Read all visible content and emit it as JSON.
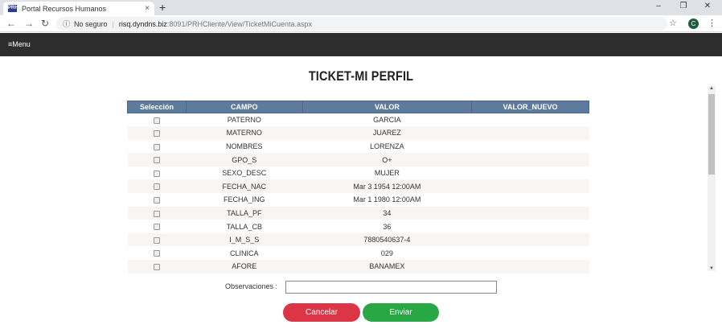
{
  "browser": {
    "tab_title": "Portal Recursos Humanos",
    "tab_favicon": "PRH",
    "tab_close": "×",
    "new_tab": "+",
    "min": "–",
    "max": "❐",
    "close": "✕",
    "back": "←",
    "forward": "→",
    "reload": "↻",
    "info_icon": "ⓘ",
    "security": "No seguro",
    "separator": "|",
    "host": "risq.dyndns.biz",
    "path": ":8091/PRHCliente/View/TicketMiCuenta.aspx",
    "star": "☆",
    "profile_initial": "C",
    "menu_dots": "⋮"
  },
  "navbar": {
    "menu_label": "≡Menu"
  },
  "page": {
    "title": "TICKET-MI PERFIL"
  },
  "grid": {
    "headers": [
      "Selección",
      "CAMPO",
      "VALOR",
      "VALOR_NUEVO"
    ],
    "rows": [
      {
        "campo": "PATERNO",
        "valor": "GARCIA",
        "nuevo": ""
      },
      {
        "campo": "MATERNO",
        "valor": "JUAREZ",
        "nuevo": ""
      },
      {
        "campo": "NOMBRES",
        "valor": "LORENZA",
        "nuevo": ""
      },
      {
        "campo": "GPO_S",
        "valor": "O+",
        "nuevo": ""
      },
      {
        "campo": "SEXO_DESC",
        "valor": "MUJER",
        "nuevo": ""
      },
      {
        "campo": "FECHA_NAC",
        "valor": "Mar 3 1954 12:00AM",
        "nuevo": ""
      },
      {
        "campo": "FECHA_ING",
        "valor": "Mar 1 1980 12:00AM",
        "nuevo": ""
      },
      {
        "campo": "TALLA_PF",
        "valor": "34",
        "nuevo": ""
      },
      {
        "campo": "TALLA_CB",
        "valor": "36",
        "nuevo": ""
      },
      {
        "campo": "I_M_S_S",
        "valor": "7880540637-4",
        "nuevo": ""
      },
      {
        "campo": "CLINICA",
        "valor": "029",
        "nuevo": ""
      },
      {
        "campo": "AFORE",
        "valor": "BANAMEX",
        "nuevo": ""
      }
    ]
  },
  "form": {
    "observaciones_label": "Observaciones :",
    "observaciones_value": ""
  },
  "buttons": {
    "cancel": "Cancelar",
    "send": "Enviar"
  },
  "colors": {
    "header": "#5d7b9d",
    "cancel": "#dc3545",
    "send": "#28a745",
    "navbar": "#2d2d2d"
  }
}
